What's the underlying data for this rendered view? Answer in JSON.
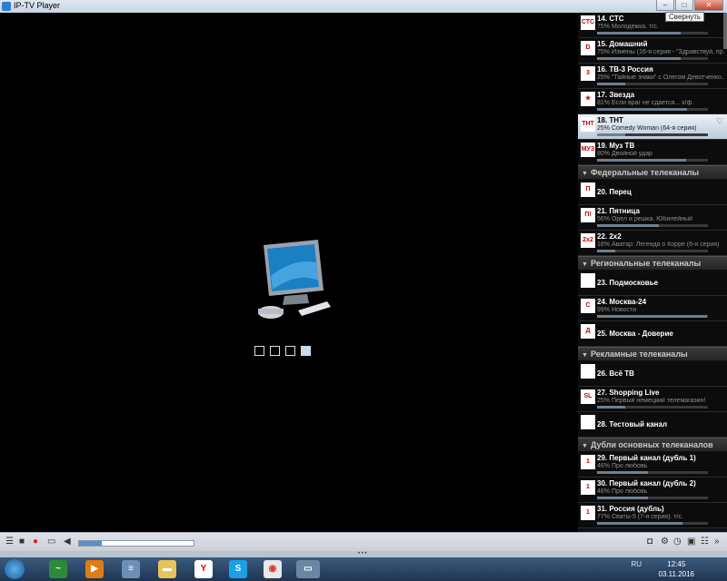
{
  "window": {
    "title": "IP-TV Player",
    "tooltip": "Свернуть"
  },
  "groups": [
    "Федеральные телеканалы",
    "Региональные телеканалы",
    "Рекламные телеканалы",
    "Дубли основных телеканалов"
  ],
  "channels": {
    "c14": {
      "name": "14. СТС",
      "prog": "75% Молодежка. т/с.",
      "logo": "СТС",
      "progress": 0.75
    },
    "c15": {
      "name": "15. Домашний",
      "prog": "75% Измены (16-я серия - \"Здравствуй, пр...",
      "logo": "D",
      "progress": 0.75
    },
    "c16": {
      "name": "16. ТВ-3 Россия",
      "prog": "25% \"Тайные знаки\" с Олегом Девотченко...",
      "logo": "3",
      "progress": 0.25
    },
    "c17": {
      "name": "17. Звезда",
      "prog": "81% Если враг не сдается... х/ф.",
      "logo": "★",
      "progress": 0.81
    },
    "c18": {
      "name": "18. ТНТ",
      "prog": "25% Comedy Woman (64-я серия)",
      "logo": "ТНТ",
      "progress": 0.25
    },
    "c19": {
      "name": "19. Муз ТВ",
      "prog": "80% Двойной удар",
      "logo": "МУЗ",
      "progress": 0.8
    },
    "c20": {
      "name": "20. Перец",
      "logo": "П"
    },
    "c21": {
      "name": "21. Пятница",
      "prog": "56% Орел и решка. Юбилейный",
      "logo": "П!",
      "progress": 0.56
    },
    "c22": {
      "name": "22. 2х2",
      "prog": "16% Аватар: Легенда о Корре (6-я серия)",
      "logo": "2x2",
      "progress": 0.16
    },
    "c23": {
      "name": "23. Подмосковье",
      "logo": ""
    },
    "c24": {
      "name": "24. Москва-24",
      "prog": "99% Новости",
      "logo": "С",
      "progress": 0.99
    },
    "c25": {
      "name": "25. Москва - Доверие",
      "logo": "Д"
    },
    "c26": {
      "name": "26. Всё ТВ",
      "logo": ""
    },
    "c27": {
      "name": "27. Shopping Live",
      "prog": "25% Первый немецкий телемагазин!",
      "logo": "SL",
      "progress": 0.25
    },
    "c28": {
      "name": "28. Тестовый канал",
      "logo": ""
    },
    "c29": {
      "name": "29. Первый канал (дубль 1)",
      "prog": "46% Про любовь",
      "logo": "1",
      "progress": 0.46
    },
    "c30": {
      "name": "30. Первый канал (дубль 2)",
      "prog": "46% Про любовь",
      "logo": "1",
      "progress": 0.46
    },
    "c31": {
      "name": "31. Россия (дубль)",
      "prog": "77% Сваты-5 (7-я серия). т/с.",
      "logo": "1",
      "progress": 0.77
    }
  },
  "volume": 0.2,
  "taskbar": {
    "lang": "RU",
    "time": "12:45",
    "date": "03.11.2016"
  },
  "colors": {
    "accent": "#5b8fd0",
    "selected": "#bccada"
  }
}
